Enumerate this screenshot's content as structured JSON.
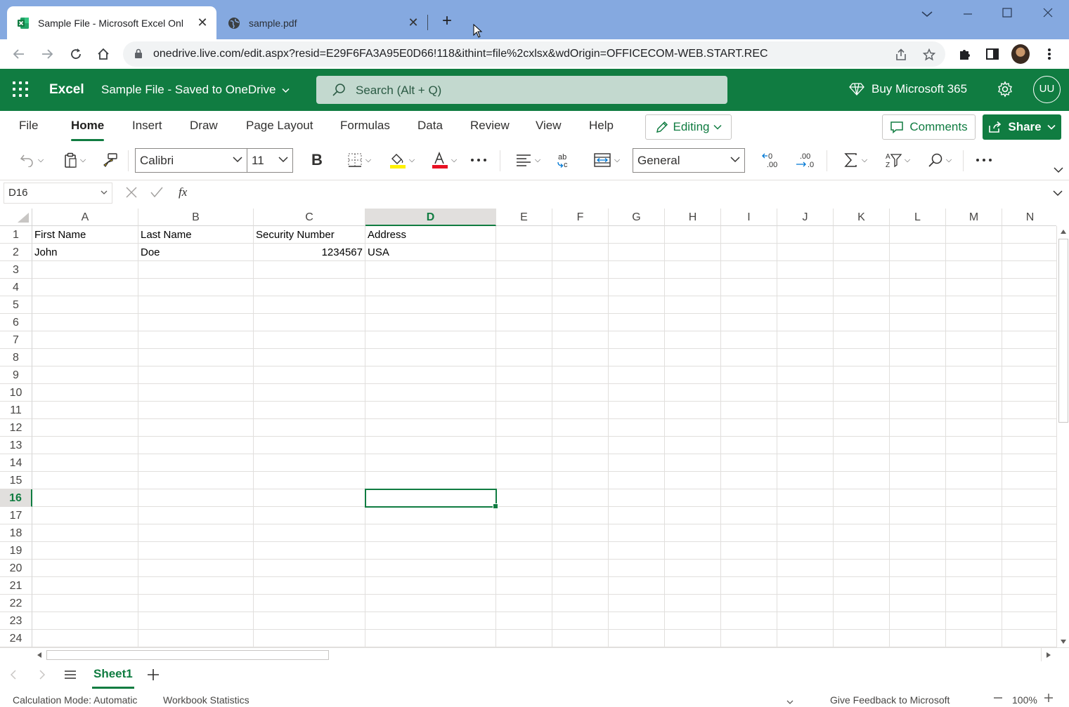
{
  "browser": {
    "tabs": [
      {
        "title": "Sample File - Microsoft Excel Onl",
        "active": true,
        "favicon": "excel-icon"
      },
      {
        "title": "sample.pdf",
        "active": false,
        "favicon": "globe-icon"
      }
    ],
    "url": "onedrive.live.com/edit.aspx?resid=E29F6FA3A95E0D66!118&ithint=file%2cxlsx&wdOrigin=OFFICECOM-WEB.START.REC"
  },
  "app": {
    "name": "Excel",
    "doc_title": "Sample File  -  Saved to OneDrive",
    "search_placeholder": "Search (Alt + Q)",
    "buy_label": "Buy Microsoft 365",
    "user_initials": "UU",
    "brand_color": "#107c41"
  },
  "ribbon": {
    "tabs": [
      "File",
      "Home",
      "Insert",
      "Draw",
      "Page Layout",
      "Formulas",
      "Data",
      "Review",
      "View",
      "Help"
    ],
    "selected_tab": "Home",
    "editing_label": "Editing",
    "comments_label": "Comments",
    "share_label": "Share",
    "font_name": "Calibri",
    "font_size": "11",
    "number_format": "General"
  },
  "formula_bar": {
    "name_box": "D16",
    "fx_label": "fx",
    "value": ""
  },
  "sheet": {
    "columns": [
      "A",
      "B",
      "C",
      "D",
      "E",
      "F",
      "G",
      "H",
      "I",
      "J",
      "K",
      "L",
      "M",
      "N"
    ],
    "rows": [
      "1",
      "2",
      "3",
      "4",
      "5",
      "6",
      "7",
      "8",
      "9",
      "10",
      "11",
      "12",
      "13",
      "14",
      "15",
      "16",
      "17",
      "18",
      "19",
      "20",
      "21",
      "22",
      "23",
      "24"
    ],
    "selected_column": "D",
    "selected_row": "16",
    "cells": {
      "A1": "First Name",
      "B1": "Last Name",
      "C1": "Security Number",
      "D1": "Address",
      "A2": "John",
      "B2": "Doe",
      "C2": "1234567",
      "D2": "USA"
    },
    "tab_name": "Sheet1"
  },
  "status": {
    "calc_mode": "Calculation Mode: Automatic",
    "workbook_stats": "Workbook Statistics",
    "feedback": "Give Feedback to Microsoft",
    "zoom": "100%"
  }
}
